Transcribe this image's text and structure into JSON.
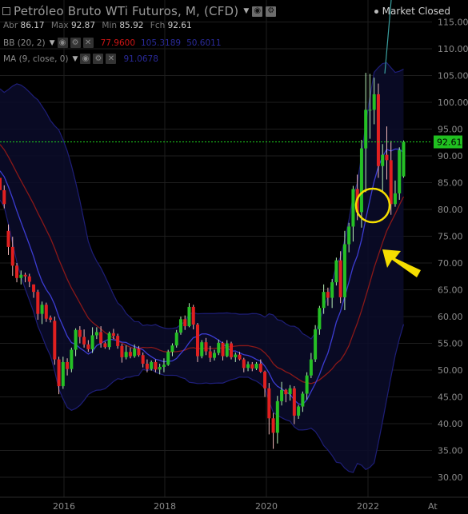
{
  "header": {
    "title": "Petróleo Bruto WTi Futuros, M, (CFD)",
    "ohlc": [
      {
        "k": "Abr",
        "v": "86.17"
      },
      {
        "k": "Max",
        "v": "92.87"
      },
      {
        "k": "Min",
        "v": "85.92"
      },
      {
        "k": "Fch",
        "v": "92.61"
      }
    ],
    "status": "Market Closed"
  },
  "indicators": {
    "bb": {
      "label": "BB (20, 2)",
      "v1": "77.9600",
      "v2": "105.3189",
      "v3": "50.6011",
      "c1": "#d01515",
      "c2": "#2a2a9a",
      "c3": "#2a2a9a"
    },
    "ma": {
      "label": "MA (9, close, 0)",
      "v1": "91.0678",
      "c1": "#2a2a9a"
    }
  },
  "chart_data": {
    "type": "candlestick",
    "y_ticks": [
      "115.00",
      "110.00",
      "105.00",
      "100.00",
      "95.00",
      "90.00",
      "85.00",
      "80.00",
      "75.00",
      "70.00",
      "65.00",
      "60.00",
      "55.00",
      "50.00",
      "45.00",
      "40.00",
      "35.00",
      "30.00"
    ],
    "x_ticks": [
      "2016",
      "2018",
      "2020",
      "2022",
      "At"
    ],
    "ylim": [
      27.5,
      118.5
    ],
    "current_price": "92.61",
    "current_price_value": 92.61,
    "colors": {
      "up": "#25c025",
      "down": "#e02020",
      "ma": "#3c3cd2",
      "bb_mid": "#8a1818",
      "price_line": "#1fd61f",
      "annotation": "#f5de00"
    },
    "candles": [
      [
        85.9,
        85.9,
        84.2,
        83.6
      ],
      [
        83.6,
        84.5,
        80.2,
        81.0
      ],
      [
        76,
        77.2,
        71.5,
        73.0
      ],
      [
        73,
        74.9,
        67.6,
        69.5
      ],
      [
        69.5,
        70.0,
        66.4,
        67.2
      ],
      [
        67.2,
        68.6,
        66.0,
        67.8
      ],
      [
        67.8,
        68.2,
        66.4,
        67.5
      ],
      [
        67.5,
        68.0,
        65.5,
        66.5
      ],
      [
        66,
        66,
        63.5,
        64.6
      ],
      [
        64.6,
        65.0,
        59.4,
        60.5
      ],
      [
        60.5,
        62.8,
        58.6,
        62.2
      ],
      [
        62.2,
        62.6,
        59.0,
        59.6
      ],
      [
        59.8,
        60.2,
        58.9,
        59.4
      ],
      [
        59.2,
        60.0,
        51.0,
        52.0
      ],
      [
        52,
        52.5,
        45.5,
        47.0
      ],
      [
        47,
        52.5,
        46.5,
        51.5
      ],
      [
        51.5,
        52.2,
        49.0,
        50.2
      ],
      [
        50.2,
        54.2,
        49.6,
        53.8
      ],
      [
        53.8,
        57.8,
        52.6,
        57.5
      ],
      [
        57.5,
        58.2,
        55.0,
        56.2
      ],
      [
        56.2,
        57.6,
        54.2,
        54.8
      ],
      [
        54.8,
        55.6,
        53.4,
        53.9
      ],
      [
        53.9,
        58.0,
        53.2,
        56.5
      ],
      [
        56.5,
        58.0,
        55.8,
        57.1
      ],
      [
        57.1,
        58.2,
        54.2,
        55.0
      ],
      [
        55,
        55.3,
        54.0,
        54.3
      ],
      [
        54.3,
        57.2,
        53.8,
        56.9
      ],
      [
        56.9,
        57.7,
        55.8,
        56.4
      ],
      [
        56.4,
        56.8,
        54.0,
        54.5
      ],
      [
        54.5,
        54.9,
        51.4,
        52.4
      ],
      [
        52.4,
        54.6,
        52.0,
        53.4
      ],
      [
        53.4,
        54.2,
        52.2,
        52.6
      ],
      [
        52.6,
        54.8,
        52.3,
        54.0
      ],
      [
        54,
        54.5,
        52.5,
        52.8
      ],
      [
        52.8,
        53.3,
        50.5,
        51.2
      ],
      [
        51.2,
        52.0,
        49.6,
        50.2
      ],
      [
        50.2,
        51.8,
        49.9,
        51.5
      ],
      [
        51.5,
        52.0,
        49.6,
        50.1
      ],
      [
        50.1,
        51.2,
        49.2,
        50.6
      ],
      [
        50.6,
        52.2,
        49.6,
        51.0
      ],
      [
        51,
        53.8,
        50.8,
        53.4
      ],
      [
        53.4,
        55.0,
        52.6,
        54.6
      ],
      [
        54.6,
        57.5,
        54.2,
        57.0
      ],
      [
        57,
        60.0,
        56.6,
        59.5
      ],
      [
        59.5,
        60.2,
        57.5,
        58.2
      ],
      [
        58.2,
        62.5,
        58.0,
        61.8
      ],
      [
        61.8,
        62.2,
        57.6,
        58.5
      ],
      [
        58.5,
        58.8,
        51.5,
        52.6
      ],
      [
        52.6,
        55.6,
        52.2,
        55.2
      ],
      [
        55.2,
        56.0,
        52.8,
        53.5
      ],
      [
        53.5,
        54.5,
        51.5,
        52.3
      ],
      [
        52.3,
        53.8,
        51.8,
        53.2
      ],
      [
        53.2,
        55.7,
        52.8,
        55.1
      ],
      [
        55.1,
        55.3,
        51.8,
        52.6
      ],
      [
        52.6,
        55.6,
        52.4,
        55.0
      ],
      [
        55,
        55.3,
        52.0,
        52.4
      ],
      [
        52.4,
        53.3,
        51.5,
        52.9
      ],
      [
        52.9,
        53.4,
        51.8,
        52.0
      ],
      [
        52,
        52.3,
        49.6,
        50.4
      ],
      [
        50.4,
        51.6,
        49.8,
        51.1
      ],
      [
        51.1,
        51.5,
        49.8,
        50.3
      ],
      [
        50.3,
        51.5,
        50.0,
        51.2
      ],
      [
        51.2,
        52.0,
        49.5,
        49.7
      ],
      [
        49.7,
        49.9,
        45.0,
        46.6
      ],
      [
        46.6,
        47.6,
        38.0,
        41.0
      ],
      [
        41,
        42.0,
        35.3,
        38.3
      ],
      [
        38.3,
        45.2,
        36.3,
        44.2
      ],
      [
        44.2,
        47.8,
        43.4,
        46.3
      ],
      [
        46.3,
        46.5,
        44.0,
        45.5
      ],
      [
        45.5,
        47.2,
        44.3,
        46.6
      ],
      [
        46.6,
        47.0,
        39.9,
        41.5
      ],
      [
        41.5,
        43.5,
        40.9,
        43.2
      ],
      [
        43.2,
        46.0,
        42.2,
        45.6
      ],
      [
        45.6,
        49.6,
        44.5,
        49.0
      ],
      [
        49,
        53.2,
        48.5,
        52.0
      ],
      [
        52,
        58.4,
        51.5,
        57.6
      ],
      [
        57.6,
        62.0,
        56.6,
        61.6
      ],
      [
        61.6,
        66.0,
        60.5,
        64.6
      ],
      [
        64.6,
        65.4,
        62.0,
        63.5
      ],
      [
        63.5,
        67.0,
        61.6,
        66.4
      ],
      [
        66.4,
        71.0,
        65.8,
        70.5
      ],
      [
        70.5,
        72.2,
        62.5,
        63.6
      ],
      [
        63.6,
        76.0,
        61.2,
        73.5
      ],
      [
        73.5,
        77.5,
        72.0,
        76.8
      ],
      [
        76.8,
        84.4,
        74.0,
        83.8
      ],
      [
        83.8,
        86.5,
        78.0,
        79.5
      ],
      [
        79.5,
        93.0,
        76.6,
        91.4
      ],
      [
        91.4,
        105.5,
        83.2,
        98.6
      ],
      [
        98.6,
        105.3,
        93.2,
        98.6
      ],
      [
        98.6,
        104.6,
        95.9,
        101.5
      ],
      [
        101.5,
        103.5,
        85.9,
        88.1
      ],
      [
        88.1,
        92.2,
        83.2,
        90.2
      ],
      [
        90.2,
        95.5,
        85.6,
        89.2
      ],
      [
        89.2,
        92.8,
        79.0,
        81.0
      ],
      [
        81,
        85.4,
        80.5,
        83.0
      ],
      [
        83,
        91.6,
        81.8,
        91.1
      ],
      [
        86.17,
        92.87,
        85.92,
        92.61
      ]
    ]
  }
}
